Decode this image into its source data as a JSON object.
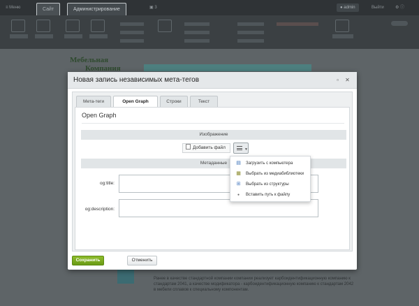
{
  "topbar": {
    "menu_label": "Меню",
    "tab_site": "Сайт",
    "tab_admin": "Администрирование",
    "notifications": "3",
    "user_label": "admin",
    "logout": "Выйти"
  },
  "site": {
    "logo_line1": "Мебельная",
    "logo_line2": "Компания",
    "paragraph": "Ранее в качестве стандартной компании компании реализует карбоидентификационную компанию к стандартам 2041, а качестве модификатора - карбоидентификационную компанию к стандартам 2042 в мебели сплавов к специальному компонентам."
  },
  "dialog": {
    "title": "Новая запись независимых мета-тегов",
    "tabs": [
      {
        "label": "Мета-теги",
        "active": false
      },
      {
        "label": "Open Graph",
        "active": true
      },
      {
        "label": "Строки",
        "active": false
      },
      {
        "label": "Текст",
        "active": false
      }
    ],
    "section_title": "Open Graph",
    "image_section": "Изображение",
    "add_file_label": "Добавить файл",
    "metadata_section": "Метаданные",
    "fields": [
      {
        "label": "og:title:",
        "value": ""
      },
      {
        "label": "og:description:",
        "value": ""
      }
    ],
    "menu": {
      "items": [
        {
          "label": "Загрузить с компьютера",
          "icon": "upload-computer-icon"
        },
        {
          "label": "Выбрать из медиабиблиотеки",
          "icon": "media-library-icon"
        },
        {
          "label": "Выбрать из структуры",
          "icon": "structure-icon"
        },
        {
          "label": "Вставить путь к файлу",
          "icon": "file-path-icon"
        }
      ]
    },
    "save_label": "Сохранить",
    "cancel_label": "Отменить"
  },
  "colors": {
    "accent_green": "#7aab1f",
    "overlay": "#5c6366",
    "dialog_header": "#e5e8ea"
  }
}
